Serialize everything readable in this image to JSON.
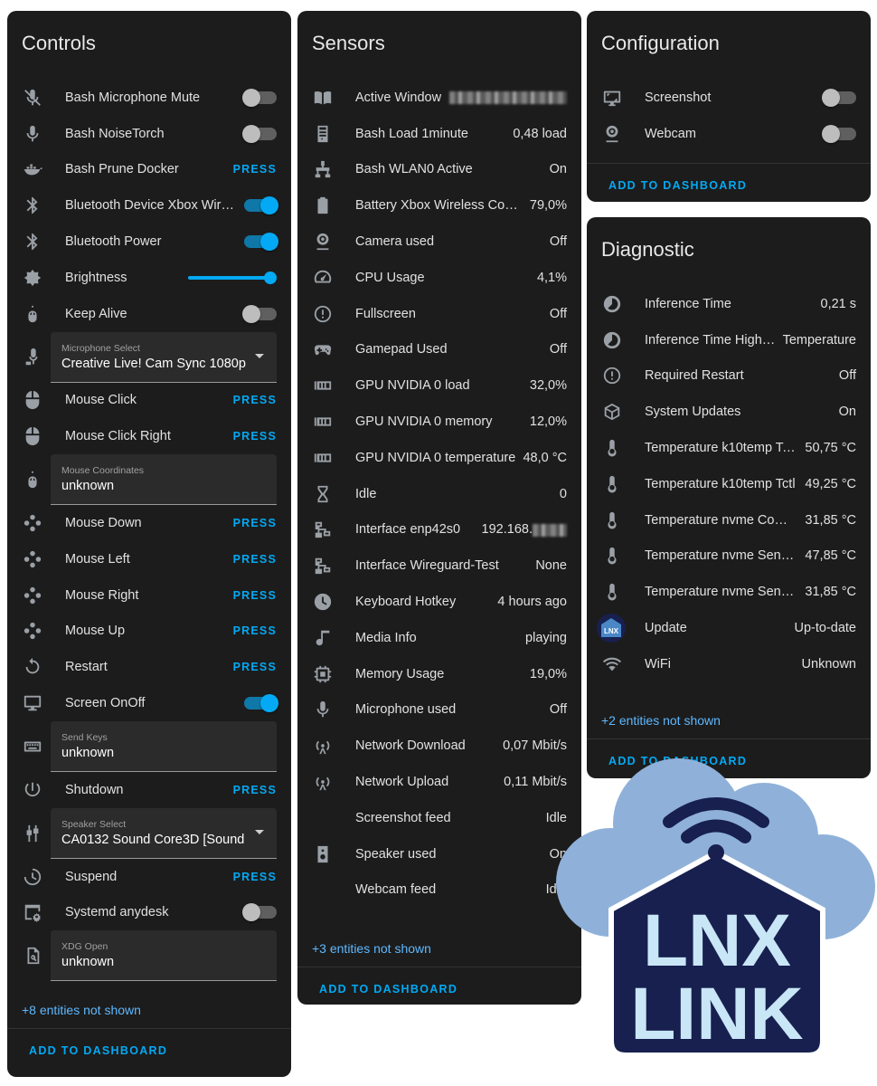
{
  "colors": {
    "card_bg": "#1c1c1c",
    "accent": "#03a9f4",
    "link": "#5eb8ff",
    "text": "#e1e1e1",
    "icon": "#9aa0a6",
    "logo_cloud": "#8fb1d9",
    "logo_house": "#17204f",
    "logo_text": "#c9e6f7"
  },
  "controls": {
    "title": "Controls",
    "rows": [
      {
        "name": "Bash Microphone Mute",
        "icon": "microphone-off-icon",
        "toggle": false
      },
      {
        "name": "Bash NoiseTorch",
        "icon": "microphone-icon",
        "toggle": false
      },
      {
        "name": "Bash Prune Docker",
        "icon": "docker-icon",
        "action": "PRESS"
      },
      {
        "name": "Bluetooth Device Xbox Wir…",
        "icon": "bluetooth-icon",
        "toggle": true
      },
      {
        "name": "Bluetooth Power",
        "icon": "bluetooth-icon",
        "toggle": true
      },
      {
        "name": "Brightness",
        "icon": "brightness-icon",
        "slider": 1.0
      },
      {
        "name": "Keep Alive",
        "icon": "mouse-cable-icon",
        "toggle": false
      },
      {
        "field": true,
        "label": "Microphone Select",
        "value": "Creative Live! Cam Sync 1080p",
        "icon": "microphone-select-icon",
        "select": true
      },
      {
        "name": "Mouse Click",
        "icon": "mouse-icon",
        "action": "PRESS"
      },
      {
        "name": "Mouse Click Right",
        "icon": "mouse-icon",
        "action": "PRESS"
      },
      {
        "field": true,
        "label": "Mouse Coordinates",
        "value": "unknown",
        "icon": "mouse-cable-icon"
      },
      {
        "name": "Mouse Down",
        "icon": "gamepad-dots-icon",
        "action": "PRESS"
      },
      {
        "name": "Mouse Left",
        "icon": "gamepad-dots-icon",
        "action": "PRESS"
      },
      {
        "name": "Mouse Right",
        "icon": "gamepad-dots-icon",
        "action": "PRESS"
      },
      {
        "name": "Mouse Up",
        "icon": "gamepad-dots-icon",
        "action": "PRESS"
      },
      {
        "name": "Restart",
        "icon": "restart-icon",
        "action": "PRESS"
      },
      {
        "name": "Screen OnOff",
        "icon": "monitor-icon",
        "toggle": true
      },
      {
        "field": true,
        "label": "Send Keys",
        "value": "unknown",
        "icon": "keyboard-icon"
      },
      {
        "name": "Shutdown",
        "icon": "power-icon",
        "action": "PRESS"
      },
      {
        "field": true,
        "label": "Speaker Select",
        "value": "CA0132 Sound Core3D [Sound",
        "icon": "speaker-select-icon",
        "select": true
      },
      {
        "name": "Suspend",
        "icon": "suspend-icon",
        "action": "PRESS"
      },
      {
        "name": "Systemd anydesk",
        "icon": "cog-window-icon",
        "toggle": false
      },
      {
        "field": true,
        "label": "XDG Open",
        "value": "unknown",
        "icon": "file-search-icon"
      }
    ],
    "more": "+8 entities not shown",
    "footer": "ADD TO DASHBOARD"
  },
  "sensors": {
    "title": "Sensors",
    "rows": [
      {
        "name": "Active Window",
        "icon": "book-open-icon",
        "value": "",
        "blurred": true
      },
      {
        "name": "Bash Load 1minute",
        "icon": "server-icon",
        "value": "0,48 load"
      },
      {
        "name": "Bash WLAN0 Active",
        "icon": "network-icon",
        "value": "On"
      },
      {
        "name": "Battery Xbox Wireless Contr…",
        "icon": "battery-icon",
        "value": "79,0%"
      },
      {
        "name": "Camera used",
        "icon": "webcam-icon",
        "value": "Off"
      },
      {
        "name": "CPU Usage",
        "icon": "speedometer-icon",
        "value": "4,1%"
      },
      {
        "name": "Fullscreen",
        "icon": "alert-circle-icon",
        "value": "Off"
      },
      {
        "name": "Gamepad Used",
        "icon": "gamepad-icon",
        "value": "Off"
      },
      {
        "name": "GPU NVIDIA 0 load",
        "icon": "gpu-icon",
        "value": "32,0%"
      },
      {
        "name": "GPU NVIDIA 0 memory",
        "icon": "gpu-icon",
        "value": "12,0%"
      },
      {
        "name": "GPU NVIDIA 0 temperature",
        "icon": "gpu-icon",
        "value": "48,0 °C"
      },
      {
        "name": "Idle",
        "icon": "hourglass-icon",
        "value": "0"
      },
      {
        "name": "Interface enp42s0",
        "icon": "lan-icon",
        "value": "192.168.",
        "blurred_suffix": true
      },
      {
        "name": "Interface Wireguard-Test",
        "icon": "lan-icon",
        "value": "None"
      },
      {
        "name": "Keyboard Hotkey",
        "icon": "clock-icon",
        "value": "4 hours ago"
      },
      {
        "name": "Media Info",
        "icon": "music-icon",
        "value": "playing"
      },
      {
        "name": "Memory Usage",
        "icon": "chip-icon",
        "value": "19,0%"
      },
      {
        "name": "Microphone used",
        "icon": "microphone-icon",
        "value": "Off"
      },
      {
        "name": "Network Download",
        "icon": "antenna-icon",
        "value": "0,07 Mbit/s"
      },
      {
        "name": "Network Upload",
        "icon": "antenna-icon",
        "value": "0,11 Mbit/s"
      },
      {
        "name": "Screenshot feed",
        "icon": "",
        "value": "Idle"
      },
      {
        "name": "Speaker used",
        "icon": "speaker-icon",
        "value": "On"
      },
      {
        "name": "Webcam feed",
        "icon": "",
        "value": "Idle"
      }
    ],
    "more": "+3 entities not shown",
    "footer": "ADD TO DASHBOARD"
  },
  "configuration": {
    "title": "Configuration",
    "rows": [
      {
        "name": "Screenshot",
        "icon": "screenshot-icon",
        "toggle": false
      },
      {
        "name": "Webcam",
        "icon": "webcam-icon",
        "toggle": false
      }
    ],
    "footer": "ADD TO DASHBOARD"
  },
  "diagnostic": {
    "title": "Diagnostic",
    "rows": [
      {
        "name": "Inference Time",
        "icon": "timelapse-icon",
        "value": "0,21 s"
      },
      {
        "name": "Inference Time Highe…",
        "icon": "timelapse-icon",
        "value": "Temperature"
      },
      {
        "name": "Required Restart",
        "icon": "alert-circle-icon",
        "value": "Off"
      },
      {
        "name": "System Updates",
        "icon": "package-icon",
        "value": "On"
      },
      {
        "name": "Temperature k10temp Tc…",
        "icon": "thermometer-icon",
        "value": "50,75 °C"
      },
      {
        "name": "Temperature k10temp Tctl",
        "icon": "thermometer-icon",
        "value": "49,25 °C"
      },
      {
        "name": "Temperature nvme Comp…",
        "icon": "thermometer-icon",
        "value": "31,85 °C"
      },
      {
        "name": "Temperature nvme Senso…",
        "icon": "thermometer-icon",
        "value": "47,85 °C"
      },
      {
        "name": "Temperature nvme Senso…",
        "icon": "thermometer-icon",
        "value": "31,85 °C"
      },
      {
        "name": "Update",
        "icon": "lnxlink-update-icon",
        "value": "Up-to-date"
      },
      {
        "name": "WiFi",
        "icon": "wifi-icon",
        "value": "Unknown"
      }
    ],
    "more": "+2 entities not shown",
    "footer": "ADD TO DASHBOARD"
  },
  "logo": {
    "line1": "LNX",
    "line2": "LINK",
    "mini": "LNX"
  }
}
